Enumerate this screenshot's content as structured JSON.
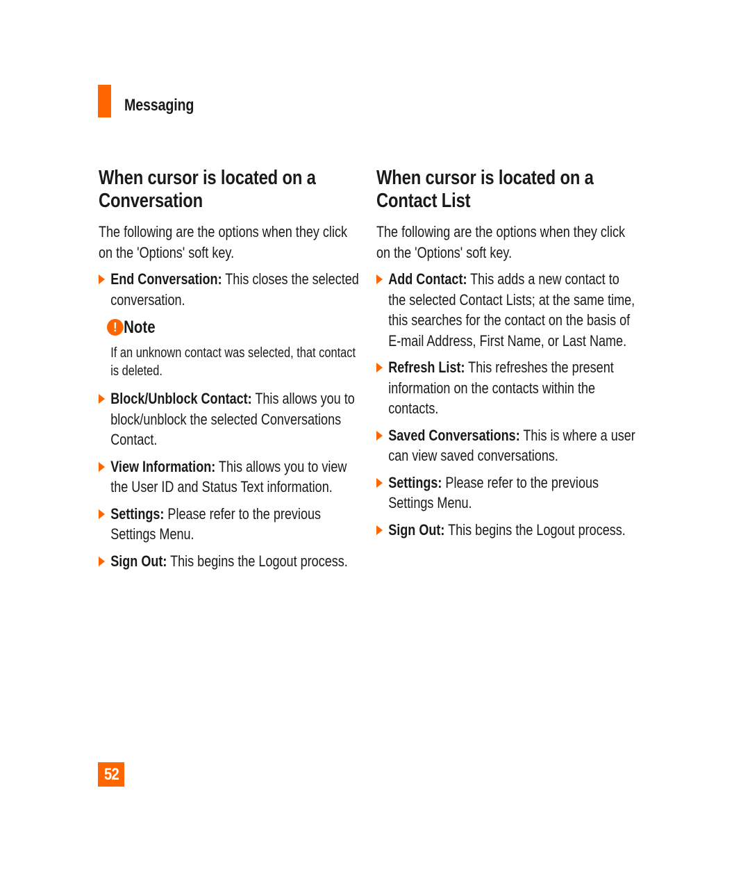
{
  "header": {
    "section": "Messaging"
  },
  "left": {
    "title": "When cursor is located on a Conversation",
    "intro": "The following are the options when they click on the 'Options' soft key.",
    "items": [
      {
        "term": "End Conversation:",
        "desc": " This closes the selected conversation."
      },
      {
        "term": "Block/Unblock Contact:",
        "desc": " This allows you to block/unblock the selected Conversations Contact."
      },
      {
        "term": "View Information:",
        "desc": " This allows you to view the User ID and Status Text information."
      },
      {
        "term": "Settings:",
        "desc": " Please refer to the previous Settings Menu."
      },
      {
        "term": "Sign Out:",
        "desc": " This begins the Logout process."
      }
    ],
    "note": {
      "icon": "!",
      "title": "Note",
      "text": "If an unknown contact was selected, that contact is deleted."
    }
  },
  "right": {
    "title": "When cursor is located on a Contact List",
    "intro": "The following are the options when they click on the 'Options' soft key.",
    "items": [
      {
        "term": "Add Contact:",
        "desc": " This adds a new contact to the selected Contact Lists; at the same time, this searches for the contact on the basis of E-mail Address, First Name, or Last Name."
      },
      {
        "term": "Refresh List:",
        "desc": " This refreshes the present information on the contacts within the contacts."
      },
      {
        "term": "Saved Conversations:",
        "desc": " This is where a user can view saved conversations."
      },
      {
        "term": "Settings:",
        "desc": " Please refer to the previous Settings Menu."
      },
      {
        "term": "Sign Out:",
        "desc": " This begins the Logout process."
      }
    ]
  },
  "footer": {
    "page_number": "52"
  },
  "colors": {
    "accent": "#ff6600"
  }
}
